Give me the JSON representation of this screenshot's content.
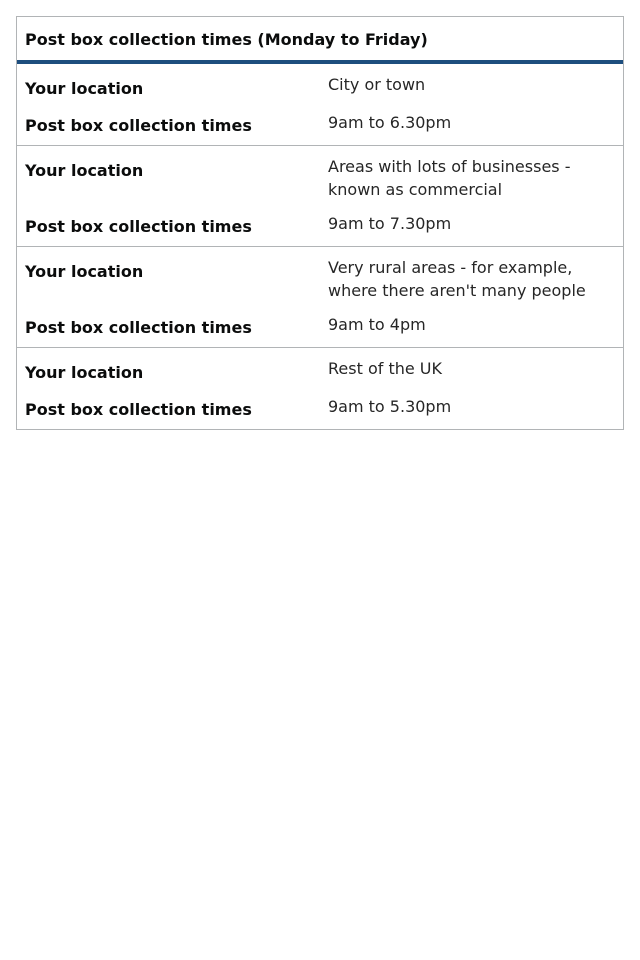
{
  "table": {
    "caption": "Post box collection times (Monday to Friday)",
    "rows": [
      {
        "location_label": "Your location",
        "location_value": "City or town",
        "times_label": "Post box collection times",
        "times_value": "9am to 6.30pm"
      },
      {
        "location_label": "Your location",
        "location_value": "Areas with lots of businesses - known as commercial",
        "times_label": "Post box collection times",
        "times_value": "9am to 7.30pm"
      },
      {
        "location_label": "Your location",
        "location_value": "Very rural areas - for example, where there aren't many people",
        "times_label": "Post box collection times",
        "times_value": "9am to 4pm"
      },
      {
        "location_label": "Your location",
        "location_value": "Rest of the UK",
        "times_label": "Post box collection times",
        "times_value": "9am to 5.30pm"
      }
    ]
  }
}
